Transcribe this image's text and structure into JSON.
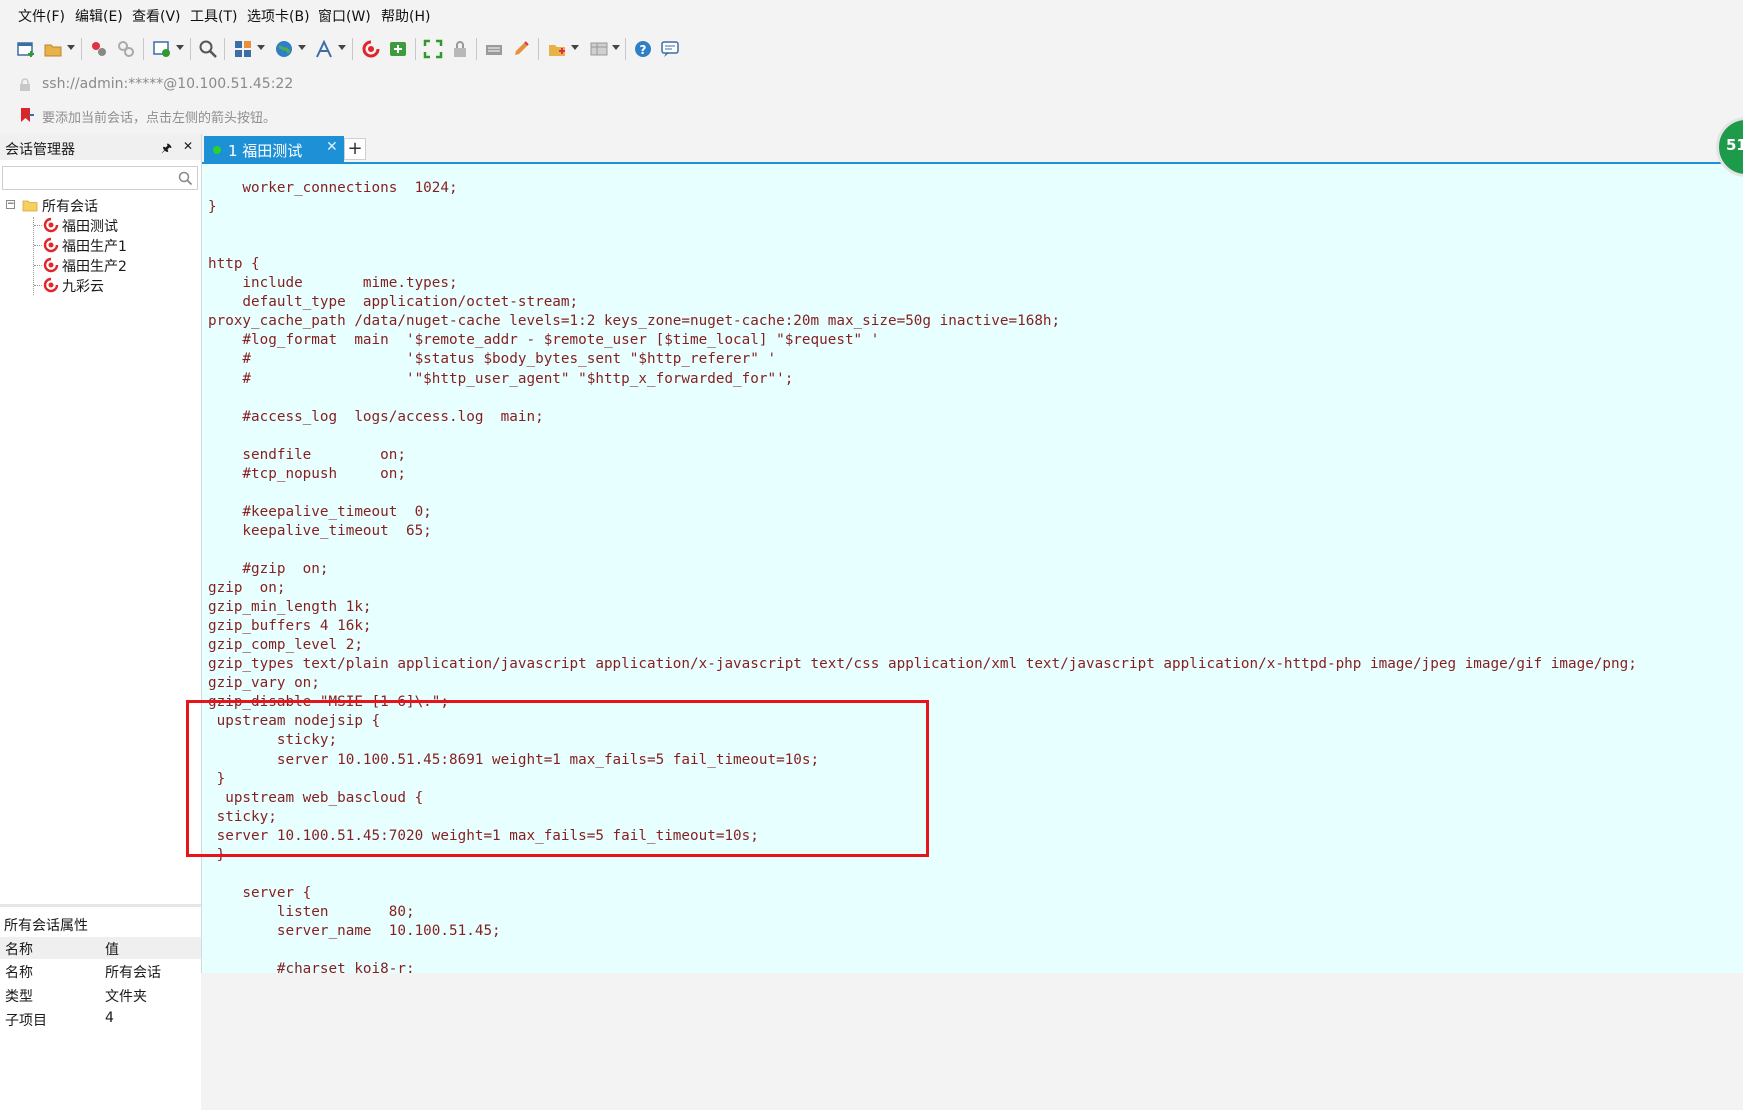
{
  "menu": [
    "文件(F)",
    "编辑(E)",
    "查看(V)",
    "工具(T)",
    "选项卡(B)",
    "窗口(W)",
    "帮助(H)"
  ],
  "address": {
    "text": "ssh://admin:*****@10.100.51.45:22"
  },
  "hint": {
    "text": "要添加当前会话，点击左侧的箭头按钮。"
  },
  "session_manager": {
    "title": "会话管理器",
    "pin_glyph": "🖈",
    "close_glyph": "✕",
    "root": "所有会话",
    "sessions": [
      "福田测试",
      "福田生产1",
      "福田生产2",
      "九彩云"
    ]
  },
  "properties": {
    "title": "所有会话属性",
    "headers": [
      "名称",
      "值"
    ],
    "rows": [
      [
        "名称",
        "所有会话"
      ],
      [
        "类型",
        "文件夹"
      ],
      [
        "子项目",
        "4"
      ]
    ]
  },
  "tab": {
    "label": "1 福田测试",
    "close": "✕",
    "add": "+"
  },
  "badge": {
    "text": "51"
  },
  "terminal_lines": [
    "    worker_connections  1024;",
    "}",
    "",
    "",
    "http {",
    "    include       mime.types;",
    "    default_type  application/octet-stream;",
    "proxy_cache_path /data/nuget-cache levels=1:2 keys_zone=nuget-cache:20m max_size=50g inactive=168h;",
    "    #log_format  main  '$remote_addr - $remote_user [$time_local] \"$request\" '",
    "    #                  '$status $body_bytes_sent \"$http_referer\" '",
    "    #                  '\"$http_user_agent\" \"$http_x_forwarded_for\"';",
    "",
    "    #access_log  logs/access.log  main;",
    "",
    "    sendfile        on;",
    "    #tcp_nopush     on;",
    "",
    "    #keepalive_timeout  0;",
    "    keepalive_timeout  65;",
    "",
    "    #gzip  on;",
    "gzip  on;",
    "gzip_min_length 1k;",
    "gzip_buffers 4 16k;",
    "gzip_comp_level 2;",
    "gzip_types text/plain application/javascript application/x-javascript text/css application/xml text/javascript application/x-httpd-php image/jpeg image/gif image/png;",
    "gzip_vary on;",
    "gzip_disable \"MSIE [1-6]\\.\";",
    " upstream nodejsip {",
    "        sticky;",
    "        server 10.100.51.45:8691 weight=1 max_fails=5 fail_timeout=10s;",
    " }",
    "  upstream web_bascloud {",
    " sticky;",
    " server 10.100.51.45:7020 weight=1 max_fails=5 fail_timeout=10s;",
    " }",
    "",
    "    server {",
    "        listen       80;",
    "        server_name  10.100.51.45;",
    "",
    "        #charset koi8-r;"
  ],
  "colors": {
    "terminal_bg": "#e7ffff",
    "terminal_text": "#861f1f",
    "tab_active": "#1e90d6",
    "highlight": "#e8141b"
  }
}
